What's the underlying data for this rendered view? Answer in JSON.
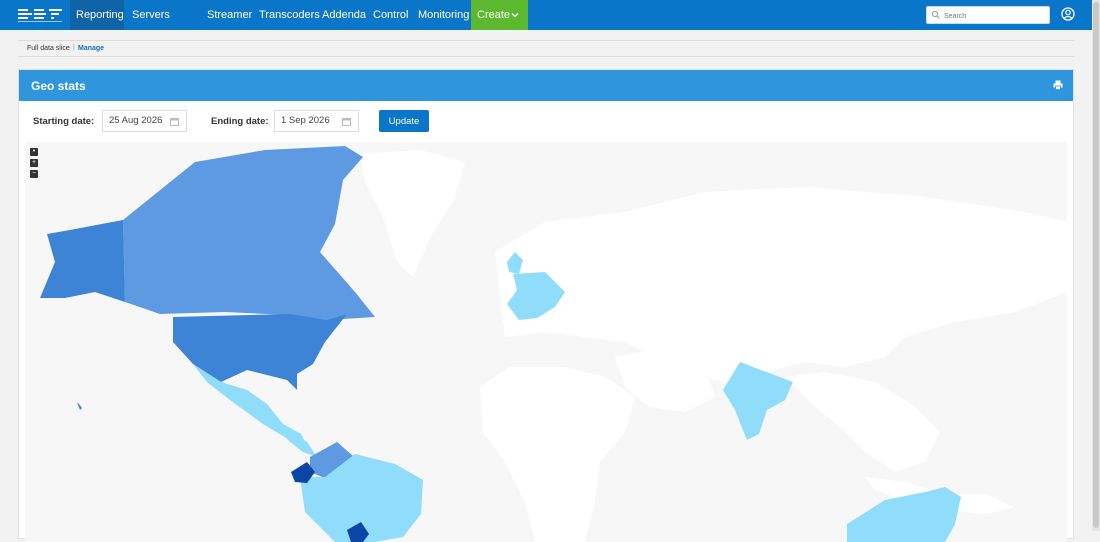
{
  "nav": {
    "items": [
      "Reporting",
      "Servers",
      "Streamer",
      "Transcoders",
      "Addenda",
      "Control",
      "Monitoring",
      "Create"
    ],
    "active": "Reporting",
    "create_color": "#5cb82e"
  },
  "search": {
    "placeholder": "Search"
  },
  "breadcrumb": {
    "current": "Full data slice",
    "separator": "|",
    "link": "Manage"
  },
  "card": {
    "title": "Geo stats"
  },
  "filters": {
    "start_label": "Starting date:",
    "start_value": "25 Aug 2026",
    "end_label": "Ending date:",
    "end_value": "1 Sep 2026",
    "update_label": "Update"
  },
  "map": {
    "zoom_controls": [
      "•",
      "+",
      "−"
    ],
    "colors": {
      "background": "#f7f7f7",
      "land": "#ffffff",
      "level1": "#8fdcfb",
      "level2": "#5d9ae2",
      "level3": "#3d84d6",
      "level4": "#0b45a6"
    }
  },
  "colors": {
    "nav": "#0a76c9",
    "header": "#2f95dc",
    "button": "#0a76c9"
  }
}
